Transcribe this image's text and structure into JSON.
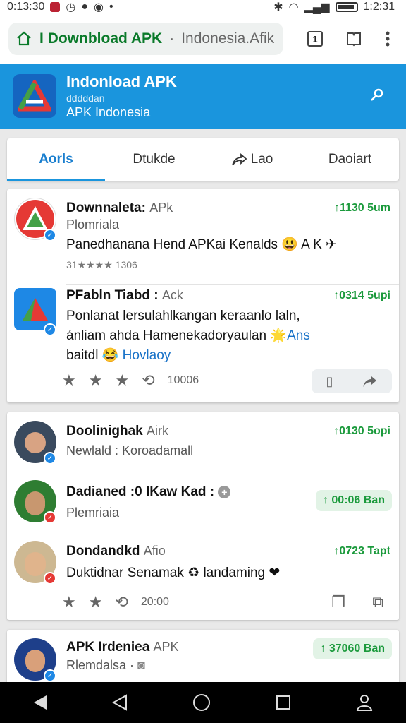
{
  "status": {
    "time_left": "0:13:30",
    "time_right": "1:2:31"
  },
  "browser": {
    "url_domain": "I Downbload APK",
    "url_sep": "·",
    "url_rest": "Indonesia.Afik",
    "tab_count": "1"
  },
  "app": {
    "title": "Indonload APK",
    "tagline": "dddddan",
    "subtitle": "APK Indonesia"
  },
  "tabs": [
    {
      "label": "Aorls"
    },
    {
      "label": "Dtukde"
    },
    {
      "label": "Lao"
    },
    {
      "label": "Daoiart"
    }
  ],
  "feed": {
    "card1": {
      "post1": {
        "name": "Downnaleta:",
        "tag": "APk",
        "time": "↑1130 5um",
        "sub": "Plomriala",
        "body": "Panedhanana Hend APKai Kenalds 😃 A K ✈",
        "rating": "31★★★★ 1306"
      },
      "post2": {
        "name": "PFabln Tiabd :",
        "tag": "Ack",
        "time": "↑0314 5upi",
        "body1": "Ponlanat lersulahlkangan keraanlo laln,",
        "body2a": "ánliam ahda Hamenekadoryaulan 🌟",
        "body2b": "Ans",
        "body3a": "baitdl 😂",
        "body3b": "Hovlaoy",
        "count": "10006"
      }
    },
    "card2": {
      "post1": {
        "name": "Doolinighak",
        "tag": "Airk",
        "time": "↑0130 5opi",
        "sub_a": "Newlald",
        "sub_b": " : Koroadamall"
      },
      "post2": {
        "name": "Dadianed :0 IKaw Kad :",
        "time": "↑ 00:06 Ban",
        "sub": "Plemriaia"
      },
      "post3": {
        "name": "Dondandkd",
        "tag": "Afio",
        "time": "↑0723 Tapt",
        "body": "Duktidnar Senamak ♻ landaming ❤",
        "count": "20:00"
      }
    },
    "card3": {
      "post1": {
        "name": "APK Irdeniea",
        "tag": "APK",
        "time": "↑ 37060 Ban",
        "sub": "Rlemdalsa ·"
      }
    }
  },
  "colors": {
    "brand": "#1a95dd",
    "accent_green": "#1b9a3c",
    "badge_blue": "#1e88e5",
    "badge_red": "#e53935"
  }
}
